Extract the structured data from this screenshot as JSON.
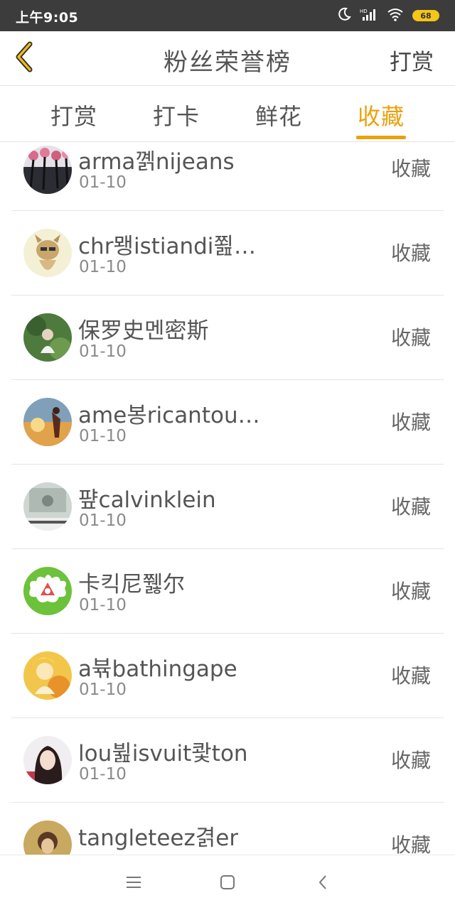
{
  "status_bar": {
    "time": "上午9:05",
    "battery": "68",
    "icons": [
      "moon-icon",
      "hd-signal-icon",
      "wifi-icon",
      "battery-icon"
    ]
  },
  "header": {
    "back_icon": "chevron-left-icon",
    "title": "粉丝荣誉榜",
    "action": "打赏"
  },
  "tabs": [
    {
      "label": "打赏",
      "active": false
    },
    {
      "label": "打卡",
      "active": false
    },
    {
      "label": "鲜花",
      "active": false
    },
    {
      "label": "收藏",
      "active": true
    }
  ],
  "colors": {
    "accent": "#e8a20e",
    "status_bar_bg": "#3c3c3c",
    "text_primary": "#555555",
    "text_secondary": "#8a8a8a",
    "divider": "#e5e5e5"
  },
  "list": [
    {
      "name": "arma꼙nijeans",
      "date": "01-10",
      "action": "收藏"
    },
    {
      "name": "chr뫵istiandi쬞…",
      "date": "01-10",
      "action": "收藏"
    },
    {
      "name": "保罗史멘密斯",
      "date": "01-10",
      "action": "收藏"
    },
    {
      "name": "ame봉ricantou…",
      "date": "01-10",
      "action": "收藏"
    },
    {
      "name": "퍞calvinklein",
      "date": "01-10",
      "action": "收藏"
    },
    {
      "name": "卡킥尼쮏尔",
      "date": "01-10",
      "action": "收藏"
    },
    {
      "name": "a뷲bathingape",
      "date": "01-10",
      "action": "收藏"
    },
    {
      "name": "lou뷢isvuit쾇ton",
      "date": "01-10",
      "action": "收藏"
    },
    {
      "name": "tangleteez겱er",
      "date": "",
      "action": "收藏"
    }
  ],
  "navbar": {
    "icons": [
      "menu-icon",
      "home-square-icon",
      "back-arrow-icon"
    ]
  }
}
